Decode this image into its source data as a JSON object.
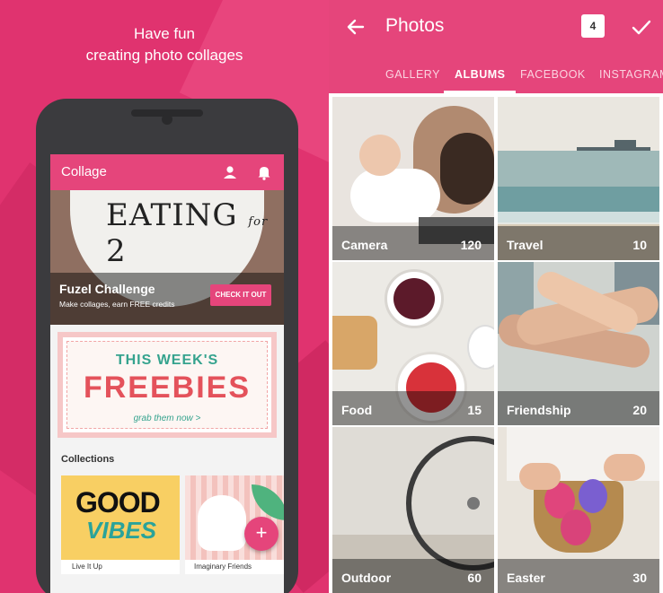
{
  "promo": {
    "tagline_line1": "Have fun",
    "tagline_line2": "creating photo collages"
  },
  "phone_app": {
    "app_title": "Collage",
    "icons": [
      "person-icon",
      "bell-icon"
    ],
    "hero": {
      "art_main": "EATING",
      "art_for": "for",
      "art_num": "2",
      "challenge_title": "Fuzel Challenge",
      "challenge_subtitle": "Make collages, earn FREE credits",
      "cta_label": "CHECK IT OUT"
    },
    "freebies": {
      "line1": "THIS WEEK'S",
      "line2": "FREEBIES",
      "line3": "grab them now >"
    },
    "collections_label": "Collections",
    "collections": [
      {
        "art_top": "GOOD",
        "art_bottom": "VIBES",
        "caption": "Live It Up"
      },
      {
        "caption": "Imaginary Friends"
      }
    ],
    "fab_label": "+"
  },
  "picker": {
    "title": "Photos",
    "selected_count": "4",
    "icons": [
      "back-arrow-icon",
      "checkmark-icon"
    ],
    "tabs": [
      {
        "label": "GALLERY",
        "active": false
      },
      {
        "label": "ALBUMS",
        "active": true
      },
      {
        "label": "FACEBOOK",
        "active": false
      },
      {
        "label": "INSTAGRAM",
        "active": false
      }
    ],
    "albums": [
      {
        "name": "Camera",
        "count": "120"
      },
      {
        "name": "Travel",
        "count": "10"
      },
      {
        "name": "Food",
        "count": "15"
      },
      {
        "name": "Friendship",
        "count": "20"
      },
      {
        "name": "Outdoor",
        "count": "60"
      },
      {
        "name": "Easter",
        "count": "30"
      }
    ]
  },
  "colors": {
    "brand_pink": "#e5457b",
    "promo_background": "#e0336f",
    "phone_body": "#3b3b3e"
  }
}
